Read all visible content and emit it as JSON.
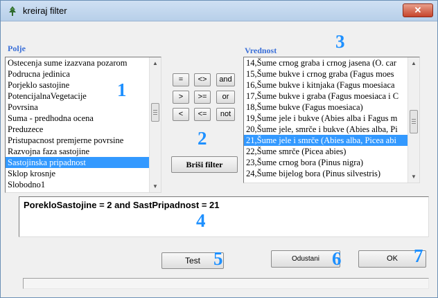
{
  "window": {
    "title": "kreiraj filter",
    "close_glyph": "✕"
  },
  "polje": {
    "label": "Polje",
    "items": [
      "Ostecenja sume izazvana pozarom",
      "Podrucna jedinica",
      "Porjeklo sastojine",
      "PotencijalnaVegetacije",
      "Povrsina",
      "Suma - predhodna ocena",
      "Preduzece",
      "Pristupacnost premjerne povrsine",
      "Razvojna faza sastojine",
      "Sastojinska pripadnost",
      "Sklop krosnje",
      "Slobodno1"
    ],
    "selected_index": 9
  },
  "operators": {
    "row1": [
      "=",
      "<>",
      "and"
    ],
    "row2": [
      ">",
      ">=",
      "or"
    ],
    "row3": [
      "<",
      "<=",
      "not"
    ]
  },
  "brisi_label": "Briši filter",
  "vrednost": {
    "label": "Vrednost",
    "items": [
      "14,Šume crnog graba i crnog jasena (O. car",
      "15,Šume bukve i crnog graba (Fagus moes",
      "16,Šume bukve i kitnjaka (Fagus moesiaca",
      "17,Šume bukve i graba (Fagus moesiaca i C",
      "18,Šume bukve (Fagus moesiaca)",
      "19,Šume jele i bukve (Abies alba i Fagus m",
      "20,Šume jele, smrče i bukve (Abies alba, Pi",
      "21,Šume jele i smrče (Abies alba, Picea abi",
      "22,Šume smrče (Picea abies)",
      "23,Šume crnog bora (Pinus nigra)",
      "24,Šume bijelog bora (Pinus silvestris)"
    ],
    "selected_index": 7
  },
  "expression": "PorekloSastojine = 2 and SastPripadnost = 21",
  "buttons": {
    "test": "Test",
    "odustani": "Odustani",
    "ok": "OK"
  },
  "annotations": [
    "1",
    "2",
    "3",
    "4",
    "5",
    "6",
    "7"
  ],
  "colors": {
    "selection": "#3399ff",
    "annotation": "#1e90ff",
    "group_label": "#3a6fd8"
  }
}
